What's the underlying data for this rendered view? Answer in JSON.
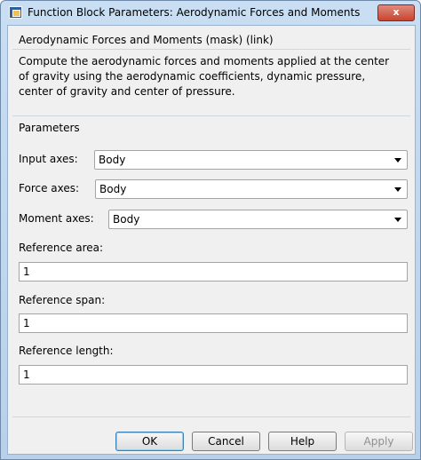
{
  "window": {
    "title": "Function Block Parameters: Aerodynamic Forces and Moments",
    "close_label": "x"
  },
  "block": {
    "header": "Aerodynamic Forces and Moments (mask) (link)",
    "description": "Compute the aerodynamic forces and moments applied at the center of gravity using the aerodynamic coefficients, dynamic pressure, center of gravity and center of pressure."
  },
  "parameters": {
    "section_label": "Parameters",
    "input_axes": {
      "label": "Input axes:",
      "value": "Body"
    },
    "force_axes": {
      "label": "Force axes:",
      "value": "Body"
    },
    "moment_axes": {
      "label": "Moment axes:",
      "value": "Body"
    },
    "reference_area": {
      "label": "Reference area:",
      "value": "1"
    },
    "reference_span": {
      "label": "Reference span:",
      "value": "1"
    },
    "reference_length": {
      "label": "Reference length:",
      "value": "1"
    }
  },
  "buttons": {
    "ok": "OK",
    "cancel": "Cancel",
    "help": "Help",
    "apply": "Apply"
  },
  "icons": {
    "window_icon": "simulink-block-icon",
    "close_icon": "close-icon",
    "dropdown_icon": "chevron-down-icon"
  }
}
